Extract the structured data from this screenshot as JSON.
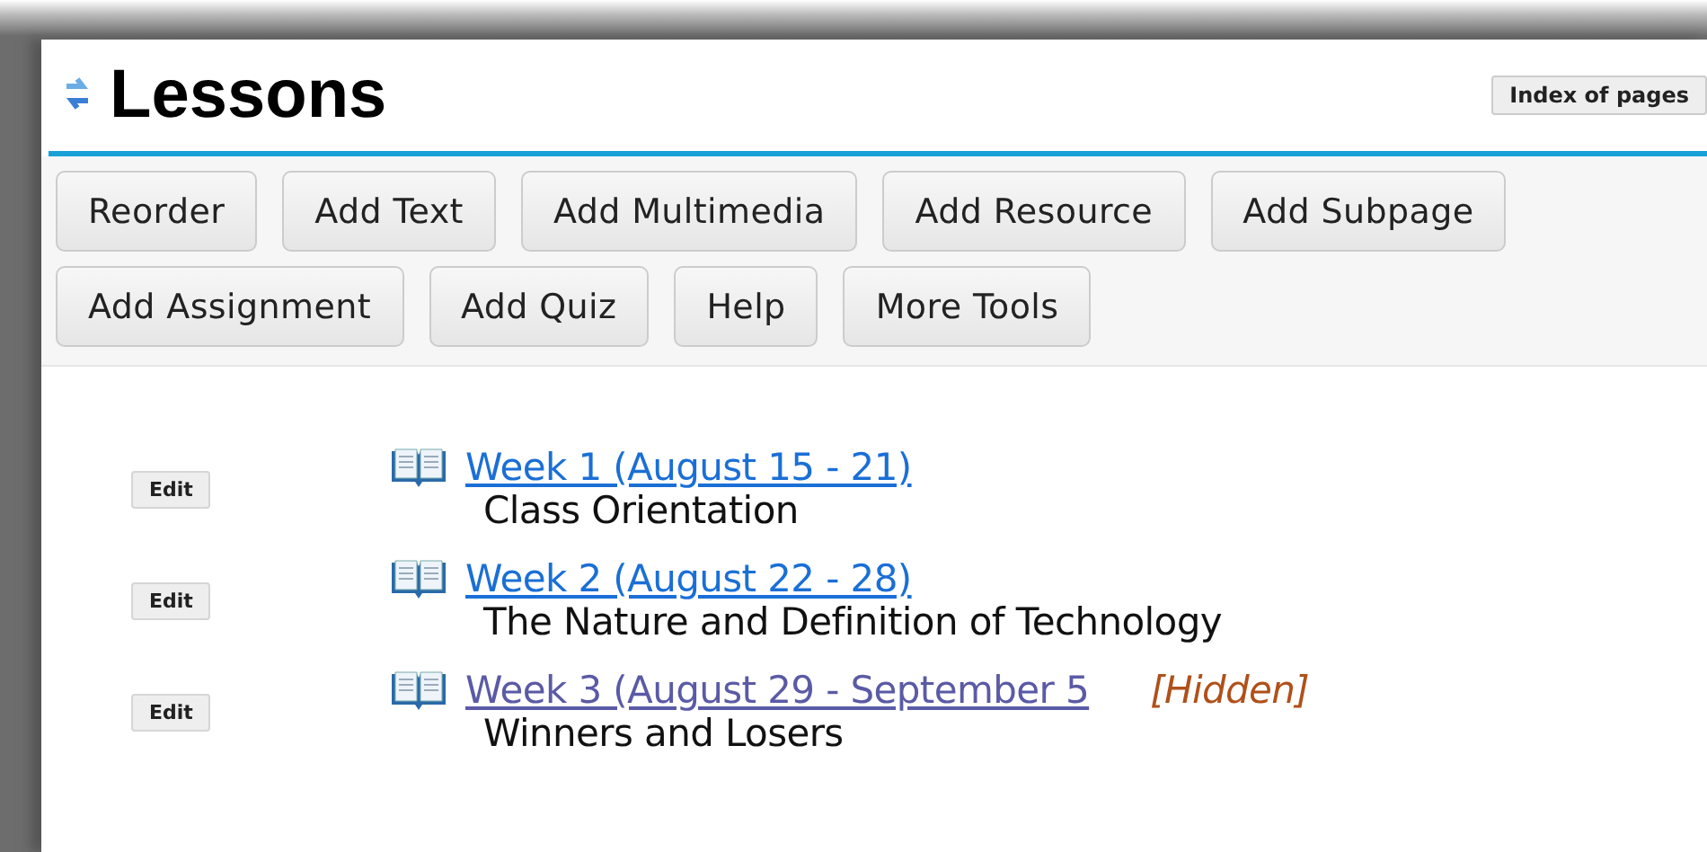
{
  "page": {
    "title": "Lessons",
    "index_button": "Index of pages"
  },
  "toolbar_rows": [
    [
      "Reorder",
      "Add Text",
      "Add Multimedia",
      "Add Resource",
      "Add Subpage"
    ],
    [
      "Add Assignment",
      "Add Quiz",
      "Help",
      "More Tools"
    ]
  ],
  "items": [
    {
      "edit": "Edit",
      "link": "Week 1 (August 15 - 21)",
      "visited": false,
      "description": "Class Orientation"
    },
    {
      "edit": "Edit",
      "link": "Week 2 (August 22 - 28)",
      "visited": false,
      "description": "The Nature and Definition of Technology"
    },
    {
      "edit": "Edit",
      "link": "Week 3 (August 29 - September 5",
      "visited": true,
      "hidden_label": "[Hidden]",
      "description": "Winners and Losers"
    }
  ]
}
